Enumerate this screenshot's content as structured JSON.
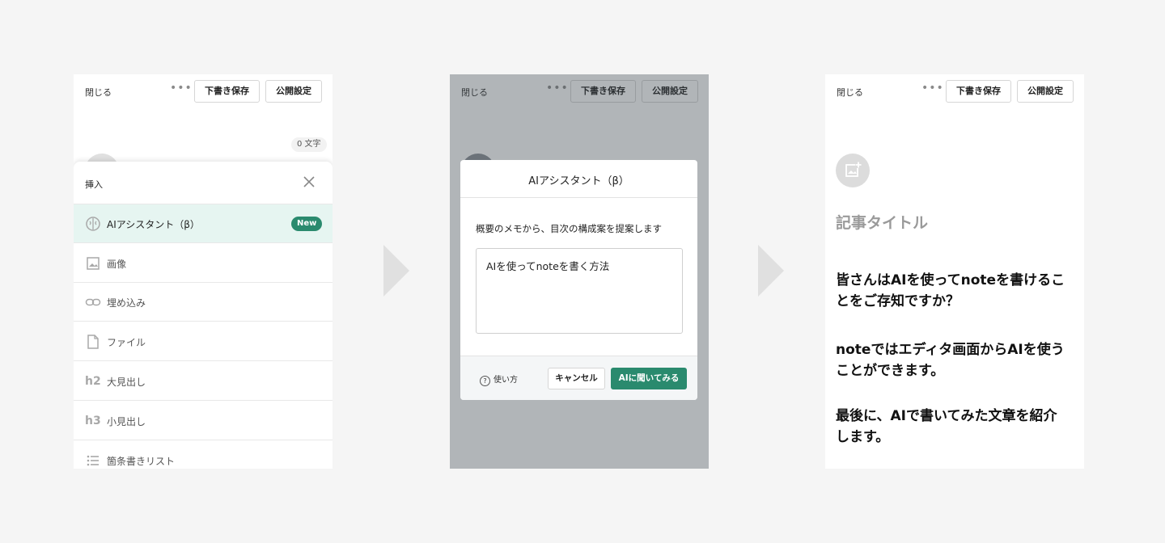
{
  "panel1": {
    "topbar": {
      "close": "閉じる",
      "more": "•••",
      "draft": "下書き保存",
      "publish": "公開設定"
    },
    "char_count": "0 文字",
    "sheet": {
      "title": "挿入",
      "items": [
        {
          "label": "AIアシスタント（β）",
          "icon": "brain-icon",
          "badge": "New"
        },
        {
          "label": "画像",
          "icon": "image-icon"
        },
        {
          "label": "埋め込み",
          "icon": "link-icon"
        },
        {
          "label": "ファイル",
          "icon": "file-icon"
        },
        {
          "label": "大見出し",
          "icon": "h2"
        },
        {
          "label": "小見出し",
          "icon": "h3"
        },
        {
          "label": "箇条書きリスト",
          "icon": "list-icon"
        }
      ]
    }
  },
  "panel2": {
    "topbar": {
      "close": "閉じる",
      "more": "•••",
      "draft": "下書き保存",
      "publish": "公開設定"
    },
    "dialog": {
      "title": "AIアシスタント（β）",
      "description": "概要のメモから、目次の構成案を提案します",
      "input_value": "AIを使ってnoteを書く方法",
      "help": "使い方",
      "cancel": "キャンセル",
      "ask": "AIに聞いてみる"
    }
  },
  "panel3": {
    "topbar": {
      "close": "閉じる",
      "more": "•••",
      "draft": "下書き保存",
      "publish": "公開設定"
    },
    "title_placeholder": "記事タイトル",
    "paragraphs": [
      "皆さんはAIを使ってnoteを書けることをご存知ですか？",
      "noteではエディタ画面からAIを使うことができます。",
      "最後に、AIで書いてみた文章を紹介します。"
    ]
  },
  "colors": {
    "accent": "#2a8a6e",
    "highlight": "#e6f5f1",
    "background": "#f5f5f5"
  }
}
